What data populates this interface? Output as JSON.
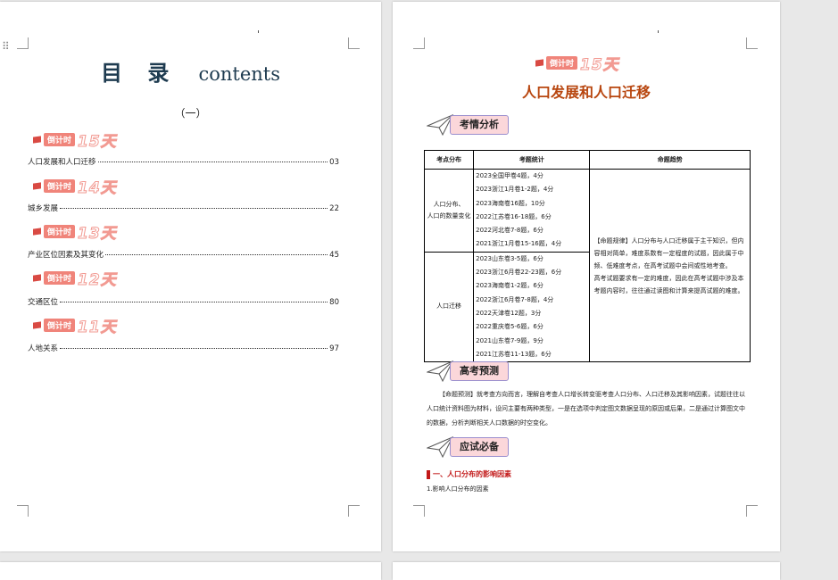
{
  "left_page": {
    "title_cn": "目 录",
    "title_en": "contents",
    "subtitle": "（一）",
    "countdown_label": "倒计时",
    "sections": [
      {
        "days": "15天",
        "entry": "人口发展和人口迁移",
        "page": "03"
      },
      {
        "days": "14天",
        "entry": "城乡发展",
        "page": "22"
      },
      {
        "days": "13天",
        "entry": "产业区位因素及其变化",
        "page": "45"
      },
      {
        "days": "12天",
        "entry": "交通区位",
        "page": "80"
      },
      {
        "days": "11天",
        "entry": "人地关系",
        "page": "97"
      }
    ]
  },
  "right_page": {
    "countdown_label": "倒计时",
    "countdown_days": "15天",
    "title": "人口发展和人口迁移",
    "sections": {
      "analysis": "考情分析",
      "prediction": "高考预测",
      "essentials": "应试必备"
    },
    "table": {
      "headers": [
        "考点分布",
        "考题统计",
        "命题趋势"
      ],
      "rows": [
        {
          "topic_line1": "人口分布、",
          "topic_line2": "人口的数量变化",
          "stats": [
            "2023全国甲卷4题，4分",
            "2023浙江1月卷1-2题，4分",
            "2023海南卷16题，10分",
            "2022江苏卷16-18题，6分",
            "2022河北卷7-8题，6分",
            "2021浙江1月卷15-16题，4分"
          ]
        },
        {
          "topic_line1": "人口迁移",
          "topic_line2": "",
          "stats": [
            "2023山东卷3-5题，6分",
            "2023浙江6月卷22-23题，6分",
            "2023海南卷1-2题，6分",
            "2022浙江6月卷7-8题，4分",
            "2022天津卷12题，3分",
            "2022重庆卷5-6题，6分",
            "2021山东卷7-9题，9分",
            "2021江苏卷11-13题，6分"
          ]
        }
      ],
      "trend_p1": "【命题规律】人口分布与人口迁移属于主干知识，但内容相对简单，难度系数有一定程度的试题，因此属于中频、低难度考点，在高考试题中会间或性地考查。",
      "trend_p2": "高考试题要求有一定的难度，因此在高考试题中涉及本考题内容时，往往通过读图和计算来提高试题的难度。"
    },
    "prediction_text": "【命题预测】就考查方向而言，理解自考查人口增长转变驱考查人口分布、人口迁移及其影响因素，试题往往以人口统计资料图为材料，设问主要有两种类型，一是在选项中判定图文数据呈现的原因或后果，二是通过计算图文中的数据，分析判断相关人口数据的时空变化。",
    "sub1": "一、人口分布的影响因素",
    "sub2": "1.影响人口分布的因素"
  }
}
